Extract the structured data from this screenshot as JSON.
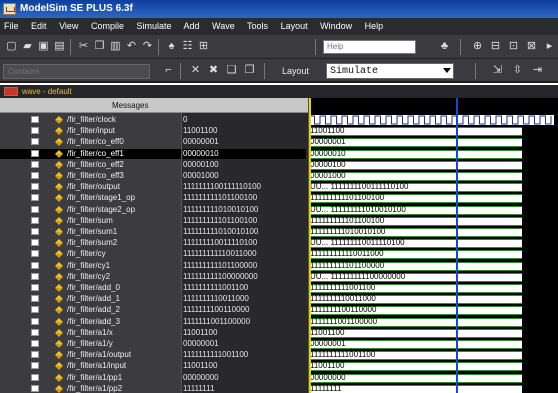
{
  "app": {
    "title": "ModelSim SE PLUS 6.3f"
  },
  "menu": [
    "File",
    "Edit",
    "View",
    "Compile",
    "Simulate",
    "Add",
    "Wave",
    "Tools",
    "Layout",
    "Window",
    "Help"
  ],
  "toolbar": {
    "help_placeholder": "Help"
  },
  "toolbar2": {
    "contains_placeholder": "Contains",
    "layout_label": "Layout",
    "layout_value": "Simulate"
  },
  "wave_window": {
    "title": "wave - default",
    "messages_header": "Messages"
  },
  "signals": [
    {
      "name": "/fir_filter/clock",
      "value": "0",
      "wave": "clock"
    },
    {
      "name": "/fir_filter/input",
      "value": "11001100",
      "wave": "11001100"
    },
    {
      "name": "/fir_filter/co_eff0",
      "value": "00000001",
      "wave": "00000001"
    },
    {
      "name": "/fir_filter/co_eff1",
      "value": "00000010",
      "wave": "00000010",
      "selected": true
    },
    {
      "name": "/fir_filter/co_eff2",
      "value": "00000100",
      "wave": "00000100"
    },
    {
      "name": "/fir_filter/co_eff3",
      "value": "00001000",
      "wave": "00001000"
    },
    {
      "name": "/fir_filter/output",
      "value": "1111111100111110100",
      "wave": "UU...  1111111100111110100"
    },
    {
      "name": "/fir_filter/stage1_op",
      "value": "111111111101100100",
      "wave": "111111111101100100"
    },
    {
      "name": "/fir_filter/stage2_op",
      "value": "111111111010010100",
      "wave": "UU...  111111111010010100"
    },
    {
      "name": "/fir_filter/sum",
      "value": "111111111101100100",
      "wave": "111111111101100100"
    },
    {
      "name": "/fir_filter/sum1",
      "value": "111111111010010100",
      "wave": "111111111010010100"
    },
    {
      "name": "/fir_filter/sum2",
      "value": "111111110011110100",
      "wave": "UU...  111111110011110100"
    },
    {
      "name": "/fir_filter/cy",
      "value": "111111111110011000",
      "wave": "111111111110011000"
    },
    {
      "name": "/fir_filter/cy1",
      "value": "111111111101100000",
      "wave": "111111111101100000"
    },
    {
      "name": "/fir_filter/cy2",
      "value": "111111111100000000",
      "wave": "UU...  111111111100000000"
    },
    {
      "name": "/fir_filter/add_0",
      "value": "1111111111001100",
      "wave": "1111111111001100"
    },
    {
      "name": "/fir_filter/add_1",
      "value": "1111111110011000",
      "wave": "1111111110011000"
    },
    {
      "name": "/fir_filter/add_2",
      "value": "1111111100110000",
      "wave": "1111111100110000"
    },
    {
      "name": "/fir_filter/add_3",
      "value": "1111111001100000",
      "wave": "1111111001100000"
    },
    {
      "name": "/fir_filter/a1/x",
      "value": "11001100",
      "wave": "11001100"
    },
    {
      "name": "/fir_filter/a1/y",
      "value": "00000001",
      "wave": "00000001"
    },
    {
      "name": "/fir_filter/a1/output",
      "value": "1111111111001100",
      "wave": "1111111111001100"
    },
    {
      "name": "/fir_filter/a1/input",
      "value": "11001100",
      "wave": "11001100"
    },
    {
      "name": "/fir_filter/a1/pp1",
      "value": "00000000",
      "wave": "00000000"
    },
    {
      "name": "/fir_filter/a1/pp2",
      "value": "11111111",
      "wave": "11111111"
    }
  ]
}
